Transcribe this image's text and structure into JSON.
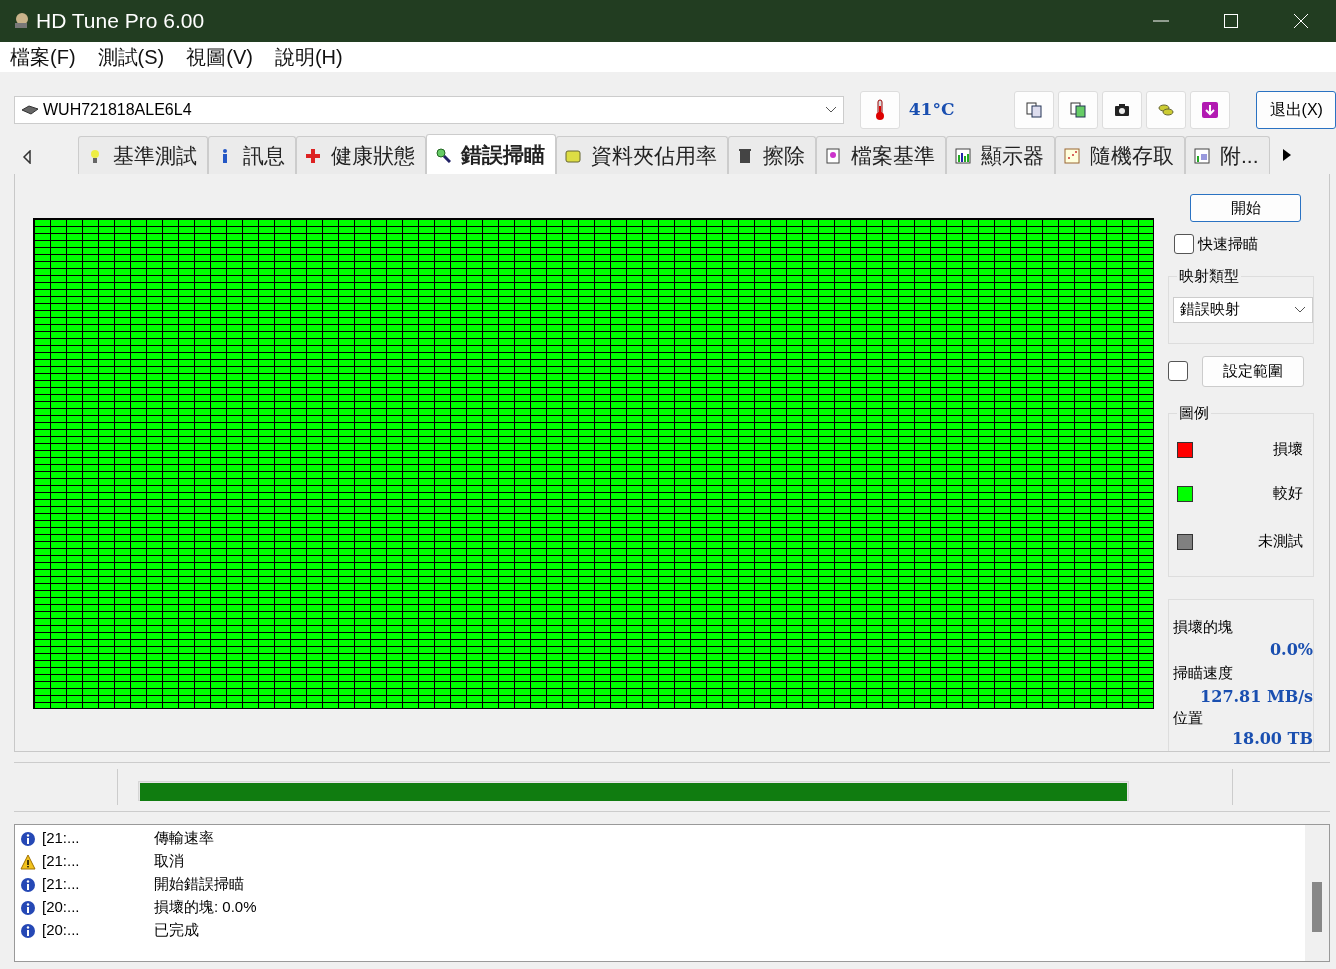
{
  "window": {
    "title": "HD Tune Pro 6.00"
  },
  "menu": [
    "檔案(F)",
    "測試(S)",
    "視圖(V)",
    "說明(H)"
  ],
  "drive": {
    "value": "WUH721818ALE6L4"
  },
  "temperature": "41°C",
  "exit_button": "退出(X)",
  "tabs": [
    {
      "label": "基準測試",
      "selected": false
    },
    {
      "label": "訊息",
      "selected": false
    },
    {
      "label": "健康狀態",
      "selected": false
    },
    {
      "label": "錯誤掃瞄",
      "selected": true
    },
    {
      "label": "資料夾佔用率",
      "selected": false
    },
    {
      "label": "擦除",
      "selected": false
    },
    {
      "label": "檔案基準",
      "selected": false
    },
    {
      "label": "顯示器",
      "selected": false
    },
    {
      "label": "隨機存取",
      "selected": false
    },
    {
      "label": "附...",
      "selected": false
    }
  ],
  "scan": {
    "start_button": "開始",
    "quick_scan": {
      "label": "快速掃瞄",
      "checked": false
    },
    "map_type": {
      "label": "映射類型",
      "value": "錯誤映射"
    },
    "range": {
      "checked": false,
      "button": "設定範圍"
    },
    "legend": {
      "title": "圖例",
      "items": [
        {
          "label": "損壞",
          "color": "#ff0000"
        },
        {
          "label": "較好",
          "color": "#00ff00"
        },
        {
          "label": "未測試",
          "color": "#808080"
        }
      ]
    },
    "stats": [
      {
        "label": "損壞的塊",
        "value": "0.0%"
      },
      {
        "label": "掃瞄速度",
        "value": "127.81 MB/s"
      },
      {
        "label": "位置",
        "value": "18.00 TB"
      }
    ]
  },
  "progress": {
    "level": 1
  },
  "log": [
    {
      "kind": "info",
      "time": "[21:...",
      "message": "傳輸速率"
    },
    {
      "kind": "warning",
      "time": "[21:...",
      "message": "取消"
    },
    {
      "kind": "info",
      "time": "[21:...",
      "message": "開始錯誤掃瞄"
    },
    {
      "kind": "info",
      "time": "[20:...",
      "message": "損壞的塊: 0.0%"
    },
    {
      "kind": "info",
      "time": "[20:...",
      "message": "已完成"
    }
  ]
}
